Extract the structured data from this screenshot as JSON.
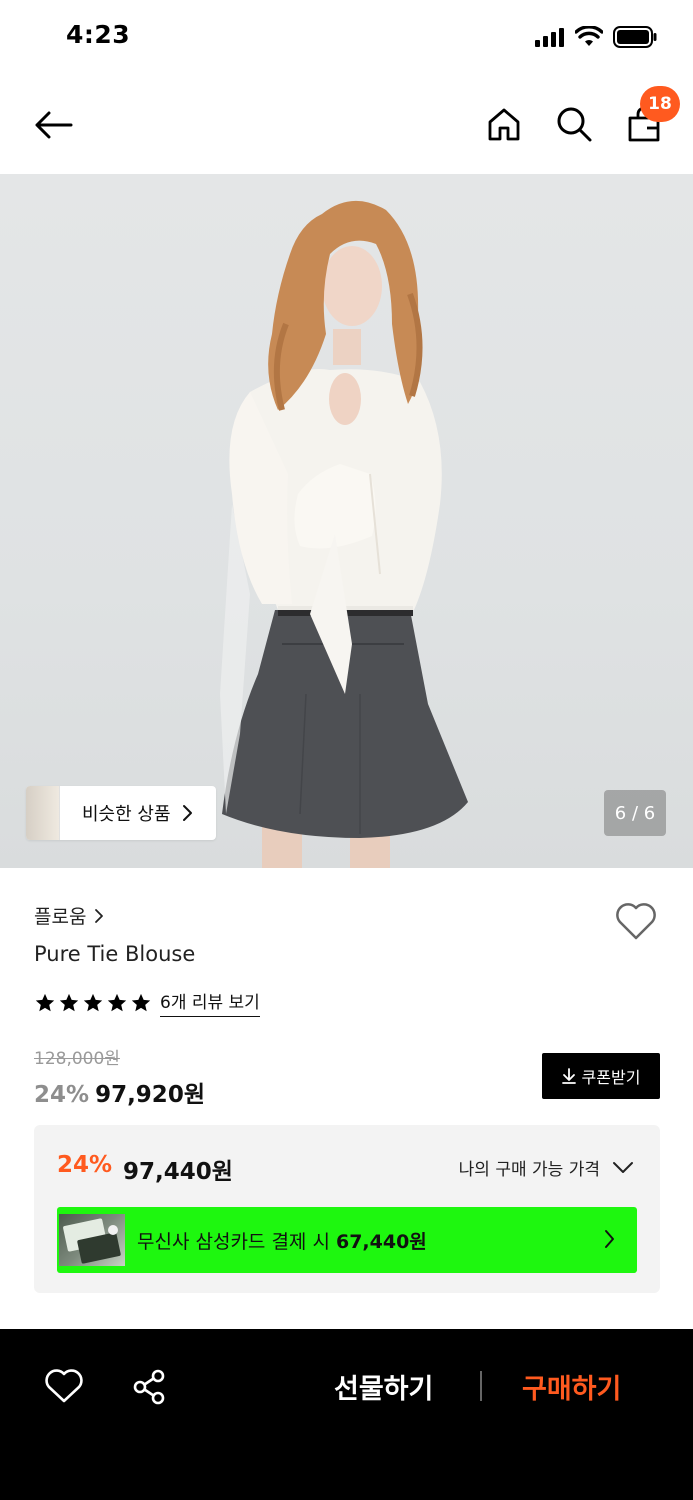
{
  "status_bar": {
    "time": "4:23"
  },
  "header": {
    "cart_count": "18"
  },
  "gallery": {
    "similar_label": "비슷한 상품",
    "page_indicator": "6 / 6"
  },
  "product": {
    "brand": "플로움",
    "title": "Pure Tie Blouse",
    "rating_stars": 5,
    "review_link": "6개 리뷰 보기",
    "original_price": "128,000원",
    "discount_pct": "24%",
    "sale_price": "97,920원",
    "coupon_label": "쿠폰받기"
  },
  "price_box": {
    "discount_pct": "24%",
    "my_price": "97,440원",
    "my_price_label": "나의 구매 가능 가격",
    "card_text": "무신사 삼성카드 결제 시 ",
    "card_price": "67,440원"
  },
  "bottom_bar": {
    "gift_label": "선물하기",
    "buy_label": "구매하기"
  },
  "colors": {
    "accent": "#ff5a1f",
    "card_banner": "#1ef70f",
    "bottom_bar": "#000000"
  }
}
